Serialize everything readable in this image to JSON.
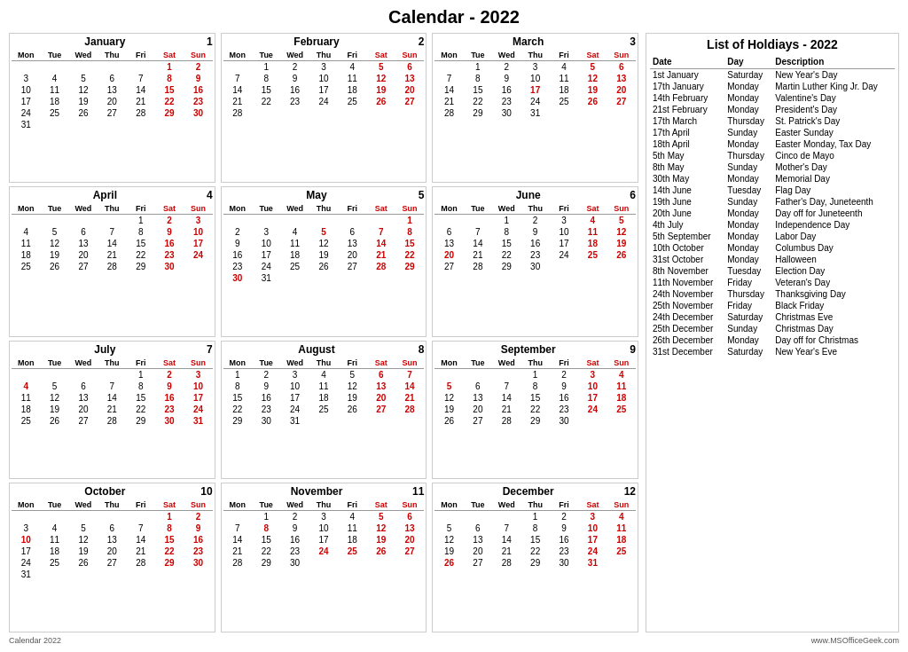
{
  "title": "Calendar - 2022",
  "holidays_title": "List of Holdiays - 2022",
  "footer_left": "Calendar 2022",
  "footer_right": "www.MSOfficeGeek.com",
  "months": [
    {
      "name": "January",
      "number": "1",
      "days": [
        [
          "",
          "",
          "",
          "",
          "",
          "1",
          "2"
        ],
        [
          "3",
          "4",
          "5",
          "6",
          "7",
          "8",
          "9"
        ],
        [
          "10",
          "11",
          "12",
          "13",
          "14",
          "15",
          "16"
        ],
        [
          "17",
          "18",
          "19",
          "20",
          "21",
          "22",
          "23"
        ],
        [
          "24",
          "25",
          "26",
          "27",
          "28",
          "29",
          "30"
        ],
        [
          "31",
          "",
          "",
          "",
          "",
          "",
          ""
        ]
      ],
      "red_dates": [
        "1",
        "2",
        "9",
        "16",
        "23",
        "30"
      ]
    },
    {
      "name": "February",
      "number": "2",
      "days": [
        [
          "",
          "1",
          "2",
          "3",
          "4",
          "5",
          "6"
        ],
        [
          "7",
          "8",
          "9",
          "10",
          "11",
          "12",
          "13"
        ],
        [
          "14",
          "15",
          "16",
          "17",
          "18",
          "19",
          "20"
        ],
        [
          "21",
          "22",
          "23",
          "24",
          "25",
          "26",
          "27"
        ],
        [
          "28",
          "",
          "",
          "",
          "",
          "",
          ""
        ]
      ],
      "red_dates": [
        "6",
        "13",
        "20",
        "27"
      ]
    },
    {
      "name": "March",
      "number": "3",
      "days": [
        [
          "",
          "1",
          "2",
          "3",
          "4",
          "5",
          "6"
        ],
        [
          "7",
          "8",
          "9",
          "10",
          "11",
          "12",
          "13"
        ],
        [
          "14",
          "15",
          "16",
          "17",
          "18",
          "19",
          "20"
        ],
        [
          "21",
          "22",
          "23",
          "24",
          "25",
          "26",
          "27"
        ],
        [
          "28",
          "29",
          "30",
          "31",
          "",
          "",
          ""
        ]
      ],
      "red_dates": [
        "6",
        "13",
        "17",
        "20",
        "27"
      ]
    },
    {
      "name": "April",
      "number": "4",
      "days": [
        [
          "",
          "",
          "",
          "",
          "1",
          "2",
          "3"
        ],
        [
          "4",
          "5",
          "6",
          "7",
          "8",
          "9",
          "10"
        ],
        [
          "11",
          "12",
          "13",
          "14",
          "15",
          "16",
          "17"
        ],
        [
          "18",
          "19",
          "20",
          "21",
          "22",
          "23",
          "24"
        ],
        [
          "25",
          "26",
          "27",
          "28",
          "29",
          "30",
          ""
        ]
      ],
      "red_dates": [
        "2",
        "3",
        "10",
        "17",
        "24"
      ]
    },
    {
      "name": "May",
      "number": "5",
      "days": [
        [
          "",
          "",
          "",
          "",
          "",
          "",
          "1"
        ],
        [
          "2",
          "3",
          "4",
          "5",
          "6",
          "7",
          "8"
        ],
        [
          "9",
          "10",
          "11",
          "12",
          "13",
          "14",
          "15"
        ],
        [
          "16",
          "17",
          "18",
          "19",
          "20",
          "21",
          "22"
        ],
        [
          "23",
          "24",
          "25",
          "26",
          "27",
          "28",
          "29"
        ],
        [
          "30",
          "31",
          "",
          "",
          "",
          "",
          ""
        ]
      ],
      "red_dates": [
        "1",
        "5",
        "8",
        "15",
        "22",
        "29",
        "30"
      ]
    },
    {
      "name": "June",
      "number": "6",
      "days": [
        [
          "",
          "",
          "1",
          "2",
          "3",
          "4",
          "5"
        ],
        [
          "6",
          "7",
          "8",
          "9",
          "10",
          "11",
          "12"
        ],
        [
          "13",
          "14",
          "15",
          "16",
          "17",
          "18",
          "19"
        ],
        [
          "20",
          "21",
          "22",
          "23",
          "24",
          "25",
          "26"
        ],
        [
          "27",
          "28",
          "29",
          "30",
          "",
          "",
          ""
        ]
      ],
      "red_dates": [
        "4",
        "5",
        "12",
        "19",
        "20",
        "26"
      ]
    },
    {
      "name": "July",
      "number": "7",
      "days": [
        [
          "",
          "",
          "",
          "",
          "1",
          "2",
          "3"
        ],
        [
          "4",
          "5",
          "6",
          "7",
          "8",
          "9",
          "10"
        ],
        [
          "11",
          "12",
          "13",
          "14",
          "15",
          "16",
          "17"
        ],
        [
          "18",
          "19",
          "20",
          "21",
          "22",
          "23",
          "24"
        ],
        [
          "25",
          "26",
          "27",
          "28",
          "29",
          "30",
          "31"
        ]
      ],
      "red_dates": [
        "2",
        "3",
        "4",
        "10",
        "17",
        "24",
        "31"
      ]
    },
    {
      "name": "August",
      "number": "8",
      "days": [
        [
          "1",
          "2",
          "3",
          "4",
          "5",
          "6",
          "7"
        ],
        [
          "8",
          "9",
          "10",
          "11",
          "12",
          "13",
          "14"
        ],
        [
          "15",
          "16",
          "17",
          "18",
          "19",
          "20",
          "21"
        ],
        [
          "22",
          "23",
          "24",
          "25",
          "26",
          "27",
          "28"
        ],
        [
          "29",
          "30",
          "31",
          "",
          "",
          "",
          ""
        ]
      ],
      "red_dates": [
        "6",
        "7",
        "14",
        "21",
        "28"
      ]
    },
    {
      "name": "September",
      "number": "9",
      "days": [
        [
          "",
          "",
          "",
          "1",
          "2",
          "3",
          "4"
        ],
        [
          "5",
          "6",
          "7",
          "8",
          "9",
          "10",
          "11"
        ],
        [
          "12",
          "13",
          "14",
          "15",
          "16",
          "17",
          "18"
        ],
        [
          "19",
          "20",
          "21",
          "22",
          "23",
          "24",
          "25"
        ],
        [
          "26",
          "27",
          "28",
          "29",
          "30",
          "",
          ""
        ]
      ],
      "red_dates": [
        "3",
        "4",
        "5",
        "11",
        "18",
        "25"
      ]
    },
    {
      "name": "October",
      "number": "10",
      "days": [
        [
          "",
          "",
          "",
          "",
          "",
          "1",
          "2"
        ],
        [
          "3",
          "4",
          "5",
          "6",
          "7",
          "8",
          "9"
        ],
        [
          "10",
          "11",
          "12",
          "13",
          "14",
          "15",
          "16"
        ],
        [
          "17",
          "18",
          "19",
          "20",
          "21",
          "22",
          "23"
        ],
        [
          "24",
          "25",
          "26",
          "27",
          "28",
          "29",
          "30"
        ],
        [
          "31",
          "",
          "",
          "",
          "",
          "",
          ""
        ]
      ],
      "red_dates": [
        "1",
        "2",
        "9",
        "10",
        "16",
        "23",
        "30"
      ]
    },
    {
      "name": "November",
      "number": "11",
      "days": [
        [
          "",
          "1",
          "2",
          "3",
          "4",
          "5",
          "6"
        ],
        [
          "7",
          "8",
          "9",
          "10",
          "11",
          "12",
          "13"
        ],
        [
          "14",
          "15",
          "16",
          "17",
          "18",
          "19",
          "20"
        ],
        [
          "21",
          "22",
          "23",
          "24",
          "25",
          "26",
          "27"
        ],
        [
          "28",
          "29",
          "30",
          "",
          "",
          "",
          ""
        ]
      ],
      "red_dates": [
        "6",
        "8",
        "13",
        "20",
        "24",
        "25",
        "27"
      ]
    },
    {
      "name": "December",
      "number": "12",
      "days": [
        [
          "",
          "",
          "",
          "1",
          "2",
          "3",
          "4"
        ],
        [
          "5",
          "6",
          "7",
          "8",
          "9",
          "10",
          "11"
        ],
        [
          "12",
          "13",
          "14",
          "15",
          "16",
          "17",
          "18"
        ],
        [
          "19",
          "20",
          "21",
          "22",
          "23",
          "24",
          "25"
        ],
        [
          "26",
          "27",
          "28",
          "29",
          "30",
          "31",
          ""
        ]
      ],
      "red_dates": [
        "3",
        "4",
        "11",
        "18",
        "24",
        "25",
        "26",
        "31"
      ]
    }
  ],
  "holidays": [
    {
      "date": "1st January",
      "day": "Saturday",
      "description": "New Year's Day"
    },
    {
      "date": "17th January",
      "day": "Monday",
      "description": "Martin Luther King Jr. Day"
    },
    {
      "date": "14th February",
      "day": "Monday",
      "description": "Valentine's Day"
    },
    {
      "date": "21st February",
      "day": "Monday",
      "description": "President's Day"
    },
    {
      "date": "17th March",
      "day": "Thursday",
      "description": "St. Patrick's Day"
    },
    {
      "date": "17th April",
      "day": "Sunday",
      "description": "Easter Sunday"
    },
    {
      "date": "18th April",
      "day": "Monday",
      "description": "Easter Monday, Tax Day"
    },
    {
      "date": "5th May",
      "day": "Thursday",
      "description": "Cinco de Mayo"
    },
    {
      "date": "8th May",
      "day": "Sunday",
      "description": "Mother's Day"
    },
    {
      "date": "30th May",
      "day": "Monday",
      "description": "Memorial Day"
    },
    {
      "date": "14th June",
      "day": "Tuesday",
      "description": "Flag Day"
    },
    {
      "date": "19th June",
      "day": "Sunday",
      "description": "Father's Day, Juneteenth"
    },
    {
      "date": "20th June",
      "day": "Monday",
      "description": "Day off for Juneteenth"
    },
    {
      "date": "4th July",
      "day": "Monday",
      "description": "Independence Day"
    },
    {
      "date": "5th September",
      "day": "Monday",
      "description": "Labor Day"
    },
    {
      "date": "10th October",
      "day": "Monday",
      "description": "Columbus Day"
    },
    {
      "date": "31st October",
      "day": "Monday",
      "description": "Halloween"
    },
    {
      "date": "8th November",
      "day": "Tuesday",
      "description": "Election Day"
    },
    {
      "date": "11th November",
      "day": "Friday",
      "description": "Veteran's Day"
    },
    {
      "date": "24th November",
      "day": "Thursday",
      "description": "Thanksgiving Day"
    },
    {
      "date": "25th November",
      "day": "Friday",
      "description": "Black Friday"
    },
    {
      "date": "24th December",
      "day": "Saturday",
      "description": "Christmas Eve"
    },
    {
      "date": "25th December",
      "day": "Sunday",
      "description": "Christmas Day"
    },
    {
      "date": "26th December",
      "day": "Monday",
      "description": "Day off for Christmas"
    },
    {
      "date": "31st December",
      "day": "Saturday",
      "description": "New Year's Eve"
    }
  ],
  "col_headers": [
    "Mon",
    "Tue",
    "Wed",
    "Thu",
    "Fri",
    "Sat",
    "Sun"
  ],
  "holiday_cols": [
    "Date",
    "Day",
    "Description"
  ]
}
